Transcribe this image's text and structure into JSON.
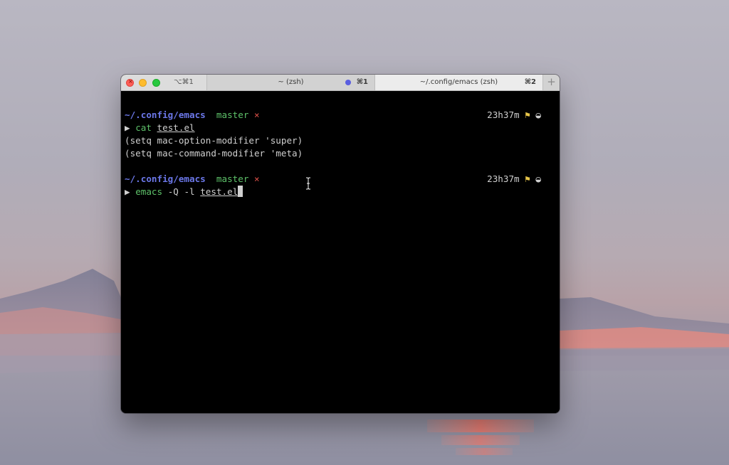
{
  "window": {
    "shortcut": "⌥⌘1",
    "tabs": [
      {
        "title": "~ (zsh)",
        "shortcut": "⌘1",
        "active": false,
        "activity_color": "#5a5ee0"
      },
      {
        "title": "~/.config/emacs (zsh)",
        "shortcut": "⌘2",
        "active": true
      }
    ],
    "new_tab_label": "+"
  },
  "terminal": {
    "block1": {
      "prompt_path": "~/.config/emacs",
      "branch": "master",
      "dirty_mark": "×",
      "elapsed": "23h37m",
      "flag_glyph": "⚑",
      "status_glyph": "◒",
      "arrow": "▶",
      "command": "cat",
      "argument": "test.el",
      "output": [
        "(setq mac-option-modifier 'super)",
        "(setq mac-command-modifier 'meta)"
      ]
    },
    "block2": {
      "prompt_path": "~/.config/emacs",
      "branch": "master",
      "dirty_mark": "×",
      "elapsed": "23h37m",
      "flag_glyph": "⚑",
      "status_glyph": "◒",
      "arrow": "▶",
      "command": "emacs",
      "flags": "-Q -l",
      "argument": "test.el"
    }
  },
  "colors": {
    "path": "#6b77e8",
    "branch": "#5ec26a",
    "dirty": "#e0524a",
    "flag": "#e8c64a"
  }
}
